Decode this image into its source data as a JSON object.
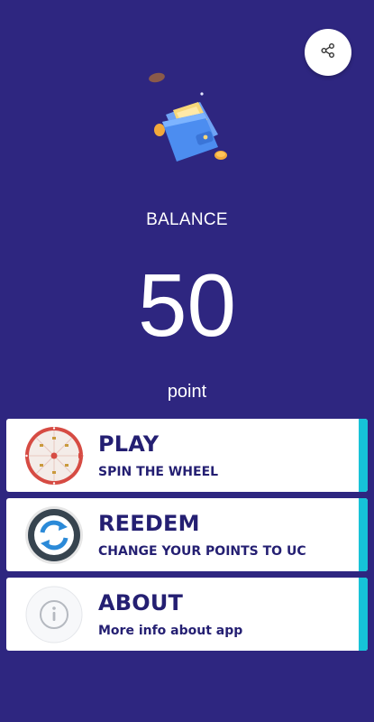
{
  "header": {
    "share_icon": "share-icon"
  },
  "balance": {
    "label": "BALANCE",
    "value": "50",
    "unit": "point"
  },
  "menu": [
    {
      "title": "PLAY",
      "subtitle": "SPIN THE WHEEL",
      "icon": "spin-wheel-icon"
    },
    {
      "title": "REEDEM",
      "subtitle": "CHANGE YOUR POINTS TO UC",
      "icon": "refresh-icon"
    },
    {
      "title": "ABOUT",
      "subtitle": "More info about app",
      "icon": "info-icon"
    }
  ],
  "colors": {
    "background": "#2e2680",
    "card": "#ffffff",
    "accent": "#16c3d8",
    "title_text": "#241f72"
  }
}
